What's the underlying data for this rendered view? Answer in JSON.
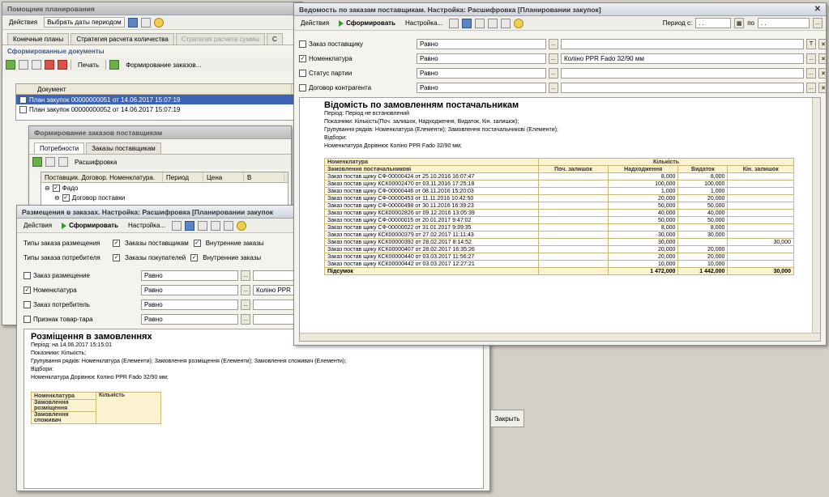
{
  "w1": {
    "title": "Помощник планирования",
    "toolbar": {
      "actions": "Действия",
      "choose_dates": "Выбрать даты периодом"
    },
    "tabs": [
      "Конечные планы",
      "Стратегия расчета количества",
      "Стратегия расчета суммы",
      "С"
    ],
    "section": "Сформированные документы",
    "doc_toolbar": {
      "print": "Печать",
      "form_orders": "Формирование заказов..."
    },
    "grid_header": "Документ",
    "rows": [
      "План закупок 00000000051 от 14.06.2017 15:07:19",
      "План закупок 00000000052 от 14.06.2017 15:07:19"
    ]
  },
  "w2": {
    "title": "Формирование заказов поставщикам",
    "tabs": [
      "Потребности",
      "Заказы поставщикам"
    ],
    "toolbar": {
      "decode": "Расшифровка"
    },
    "headers": [
      "Поставщик. Договор. Номенклатура.",
      "Период",
      "Цена",
      "В"
    ],
    "rows": [
      {
        "label": "Фадо"
      },
      {
        "label": "Договор поставки"
      }
    ]
  },
  "w3": {
    "title": "Размещения в заказах. Настройка: Расшифровка [Планировании закупок",
    "toolbar": {
      "actions": "Действия",
      "generate": "Сформировать",
      "settings": "Настройка..."
    },
    "types_place_label": "Типы заказа размещения",
    "types_place": [
      "Заказы поставщикам",
      "Внутренние заказы"
    ],
    "types_cons_label": "Типы заказа потребителя",
    "types_cons": [
      "Заказы покупателей",
      "Внутренние заказы"
    ],
    "filters": [
      {
        "label": "Заказ размещение",
        "cond": "Равно",
        "value": ""
      },
      {
        "label": "Номенклатура",
        "cond": "Равно",
        "value": "Коліно PPR"
      },
      {
        "label": "Заказ потребитель",
        "cond": "Равно",
        "value": ""
      },
      {
        "label": "Признак товар-тара",
        "cond": "Равно",
        "value": ""
      }
    ],
    "report": {
      "title": "Розміщення в замовленнях",
      "lines": [
        "Період: на 14.06.2017 15:15:01",
        "Показники: Кількість;",
        "Групування рядків: Номенклатура (Елементи); Замовлення розміщення (Елементи); Замовлення споживач (Елементи);",
        "Відбори:",
        "Номенклатура Дорівнює Коліно PPR Fado 32/90 мм;"
      ],
      "col1": [
        "Номенклатура",
        "Замовлення розміщення",
        "Замовлення споживач"
      ],
      "col2": "Кількість"
    }
  },
  "w4": {
    "title": "Ведомость по заказам поставщикам. Настройка: Расшифровка [Планировании закупок]",
    "toolbar": {
      "actions": "Действия",
      "generate": "Сформировать",
      "settings": "Настройка...",
      "period_from": "Период с:",
      "period_to": "по",
      "date_placeholder": ". ."
    },
    "filters": [
      {
        "label": "Заказ поставщику",
        "cond": "Равно",
        "value": "",
        "checked": false
      },
      {
        "label": "Номенклатура",
        "cond": "Равно",
        "value": "Коліно PPR Fado 32/90 мм",
        "checked": true
      },
      {
        "label": "Статус партии",
        "cond": "Равно",
        "value": "",
        "checked": false
      },
      {
        "label": "Договор контрагента",
        "cond": "Равно",
        "value": "",
        "checked": false
      }
    ],
    "report": {
      "title": "Відомість по замовленням постачальникам",
      "lines": [
        "Період: Період не встановлений",
        "Показники: Кількість(Поч. залишок, Надходження, Видаток, Кін. залишок);",
        "Групування рядків: Номенклатура (Елементи); Замовлення постачальникові (Елементи);",
        "Відбори:",
        "Номенклатура Дорівнює Коліно PPR Fado 32/90 мм;"
      ],
      "header1": {
        "left": "Номенклатура",
        "right": "Кількість"
      },
      "header2": [
        "Замовлення постачальникові",
        "Поч. залишок",
        "Надходження",
        "Видаток",
        "Кін. залишок"
      ],
      "rows": [
        [
          "Заказ постав щику СФ-00000424 от 25.10.2016 16:07:47",
          "",
          "8,000",
          "8,000",
          ""
        ],
        [
          "Заказ постав щику КСК00002470 от 03.11.2016 17:25:18",
          "",
          "100,000",
          "100,000",
          ""
        ],
        [
          "Заказ постав щику СФ-00000446 от 08.11.2016 15:20:03",
          "",
          "1,000",
          "1,000",
          ""
        ],
        [
          "Заказ постав щику СФ-00000453 от 11.11.2016 10:42:50",
          "",
          "20,000",
          "20,000",
          ""
        ],
        [
          "Заказ постав щику СФ-00000498 от 30.11.2016 16:39:23",
          "",
          "50,000",
          "50,000",
          ""
        ],
        [
          "Заказ постав щику КСК00002826 от 09.12.2016 13:05:39",
          "",
          "40,000",
          "40,000",
          ""
        ],
        [
          "Заказ постав щику СФ-00000015 от 20.01.2017 9:47:02",
          "",
          "50,000",
          "50,000",
          ""
        ],
        [
          "Заказ постав щику СФ-00000022 от 31.01.2017 9:39:35",
          "",
          "8,000",
          "8,000",
          ""
        ],
        [
          "Заказ постав щику КСК00000379 от 27.02.2017 11:11:43",
          "",
          "30,000",
          "30,000",
          ""
        ],
        [
          "Заказ постав щику КСК00000392 от 28.02.2017 8:14:52",
          "",
          "30,000",
          "",
          "30,000"
        ],
        [
          "Заказ постав щику КСК00000407 от 28.02.2017 16:35:26",
          "",
          "20,000",
          "20,000",
          ""
        ],
        [
          "Заказ постав щику КСК00000440 от 03.03.2017 11:56:27",
          "",
          "20,000",
          "20,000",
          ""
        ],
        [
          "Заказ постав щику КСК00000442 от 03.03.2017 12:27:21",
          "",
          "10,000",
          "10,000",
          ""
        ]
      ],
      "total": [
        "Підсумок",
        "",
        "1 472,000",
        "1 442,000",
        "30,000"
      ]
    }
  },
  "close_button": "Закрыть"
}
